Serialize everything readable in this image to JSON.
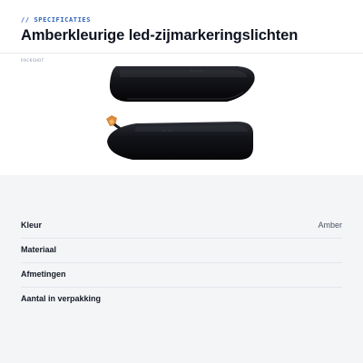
{
  "header": {
    "eyebrow": "// SPECIFICATIES",
    "title": "Amberkleurige led-zijmarkeringslichten"
  },
  "image": {
    "package_label": "PACKSHOT",
    "icon": "product-packshot-image"
  },
  "specs": [
    {
      "label": "Kleur",
      "value": "Amber"
    },
    {
      "label": "Materiaal",
      "value": ""
    },
    {
      "label": "Afmetingen",
      "value": ""
    },
    {
      "label": "Aantal in verpakking",
      "value": ""
    }
  ],
  "colors": {
    "accent": "#2f63b8",
    "page_background": "#f4f5f7",
    "panel_background": "#ffffff",
    "lamp_body": "#121318",
    "connector_amber": "#d8893a"
  }
}
